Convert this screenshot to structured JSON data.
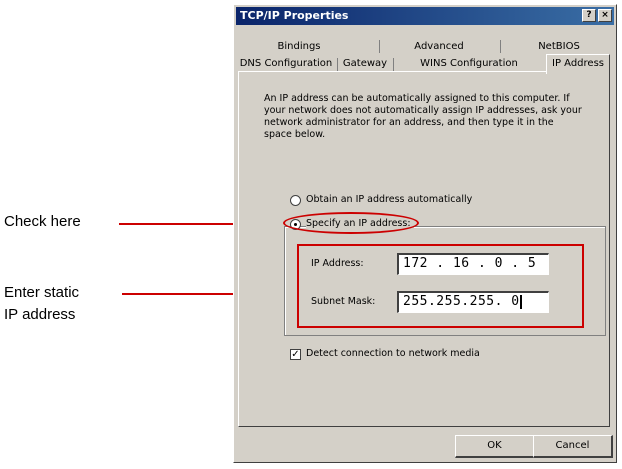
{
  "callouts": {
    "check_label": "Check here",
    "enter_label_line1": "Enter static",
    "enter_label_line2": "IP address",
    "accent_color": "#cc0000"
  },
  "dialog": {
    "title": "TCP/IP Properties",
    "help_button": "?",
    "close_button": "×",
    "tabs_row1": [
      "Bindings",
      "Advanced",
      "NetBIOS"
    ],
    "tabs_row2": [
      "DNS Configuration",
      "Gateway",
      "WINS Configuration",
      "IP Address"
    ],
    "active_tab": "IP Address",
    "description": "An IP address can be automatically assigned to this computer. If your network does not automatically assign IP addresses, ask your network administrator for an address, and then type it in the space below.",
    "radio_auto_label": "Obtain an IP address automatically",
    "radio_specify_label": "Specify an IP address:",
    "ip_address_label": "IP Address:",
    "ip_address_value": "172 . 16 . 0 . 5",
    "subnet_mask_label": "Subnet Mask:",
    "subnet_mask_value": "255.255.255. 0",
    "detect_checkbox_label": "Detect connection to network media",
    "ok_label": "OK",
    "cancel_label": "Cancel"
  },
  "icons": {
    "check_mark": "✓"
  }
}
